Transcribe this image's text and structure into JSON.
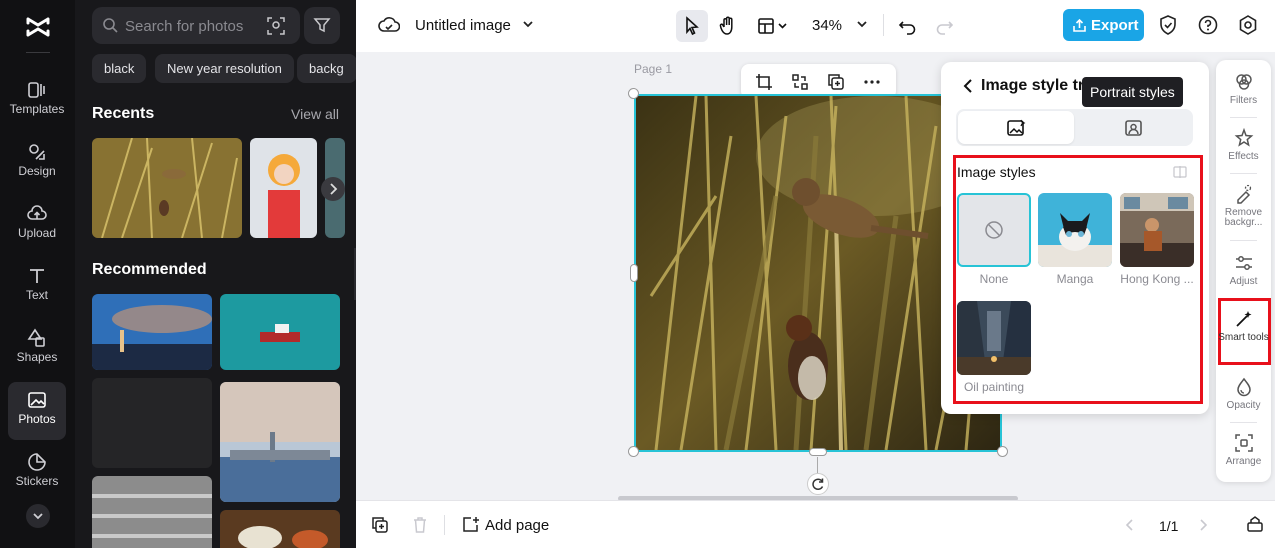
{
  "rail": {
    "items": [
      {
        "label": "Templates",
        "icon": "templates-icon"
      },
      {
        "label": "Design",
        "icon": "design-icon"
      },
      {
        "label": "Upload",
        "icon": "upload-icon"
      },
      {
        "label": "Text",
        "icon": "text-icon"
      },
      {
        "label": "Shapes",
        "icon": "shapes-icon"
      },
      {
        "label": "Photos",
        "icon": "photos-icon",
        "active": true
      },
      {
        "label": "Stickers",
        "icon": "stickers-icon"
      }
    ]
  },
  "panel": {
    "search_placeholder": "Search for photos",
    "chips": [
      "black",
      "New year resolution",
      "backg"
    ],
    "recents_title": "Recents",
    "view_all": "View all",
    "recommended_title": "Recommended"
  },
  "topbar": {
    "title": "Untitled image",
    "zoom": "34%",
    "export_label": "Export"
  },
  "canvas": {
    "page_label": "Page 1"
  },
  "popup": {
    "title": "Image style tr",
    "tooltip": "Portrait styles",
    "section_title": "Image styles",
    "styles": [
      "None",
      "Manga",
      "Hong Kong ...",
      "Oil painting"
    ]
  },
  "toolrail": {
    "items": [
      "Filters",
      "Effects",
      "Remove backgr...",
      "Adjust",
      "Smart tools",
      "Opacity",
      "Arrange"
    ]
  },
  "bottombar": {
    "add_page": "Add page",
    "pager": "1/1"
  },
  "colors": {
    "accent": "#1aa5e6",
    "highlight": "#e8101b",
    "selection": "#27c3d6"
  }
}
